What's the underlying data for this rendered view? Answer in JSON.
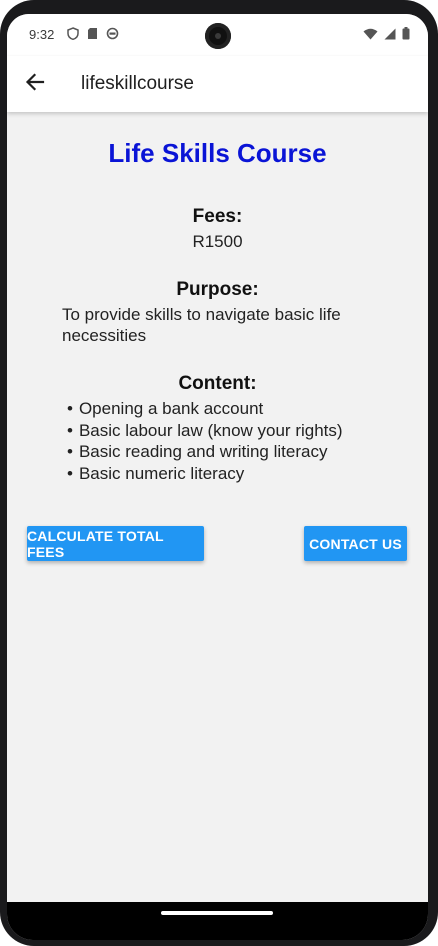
{
  "status_bar": {
    "time": "9:32",
    "left_icons": [
      "shield-icon",
      "sd-card-icon",
      "sync-icon"
    ],
    "right_icons": [
      "wifi-icon",
      "signal-icon",
      "battery-icon"
    ]
  },
  "app_bar": {
    "title": "lifeskillcourse",
    "back_icon": "arrow-back-icon"
  },
  "main": {
    "title": "Life Skills Course",
    "title_color": "#0a14d6",
    "fees_heading": "Fees:",
    "fees_value": "R1500",
    "purpose_heading": "Purpose:",
    "purpose_text": "To provide skills to navigate basic life necessities",
    "content_heading": "Content:",
    "content_items": [
      "Opening a bank account",
      "Basic labour law (know your rights)",
      "Basic reading and writing literacy",
      "Basic numeric literacy"
    ]
  },
  "buttons": {
    "calculate_label": "CALCULATE TOTAL FEES",
    "contact_label": "CONTACT US",
    "accent_color": "#2196f3"
  }
}
